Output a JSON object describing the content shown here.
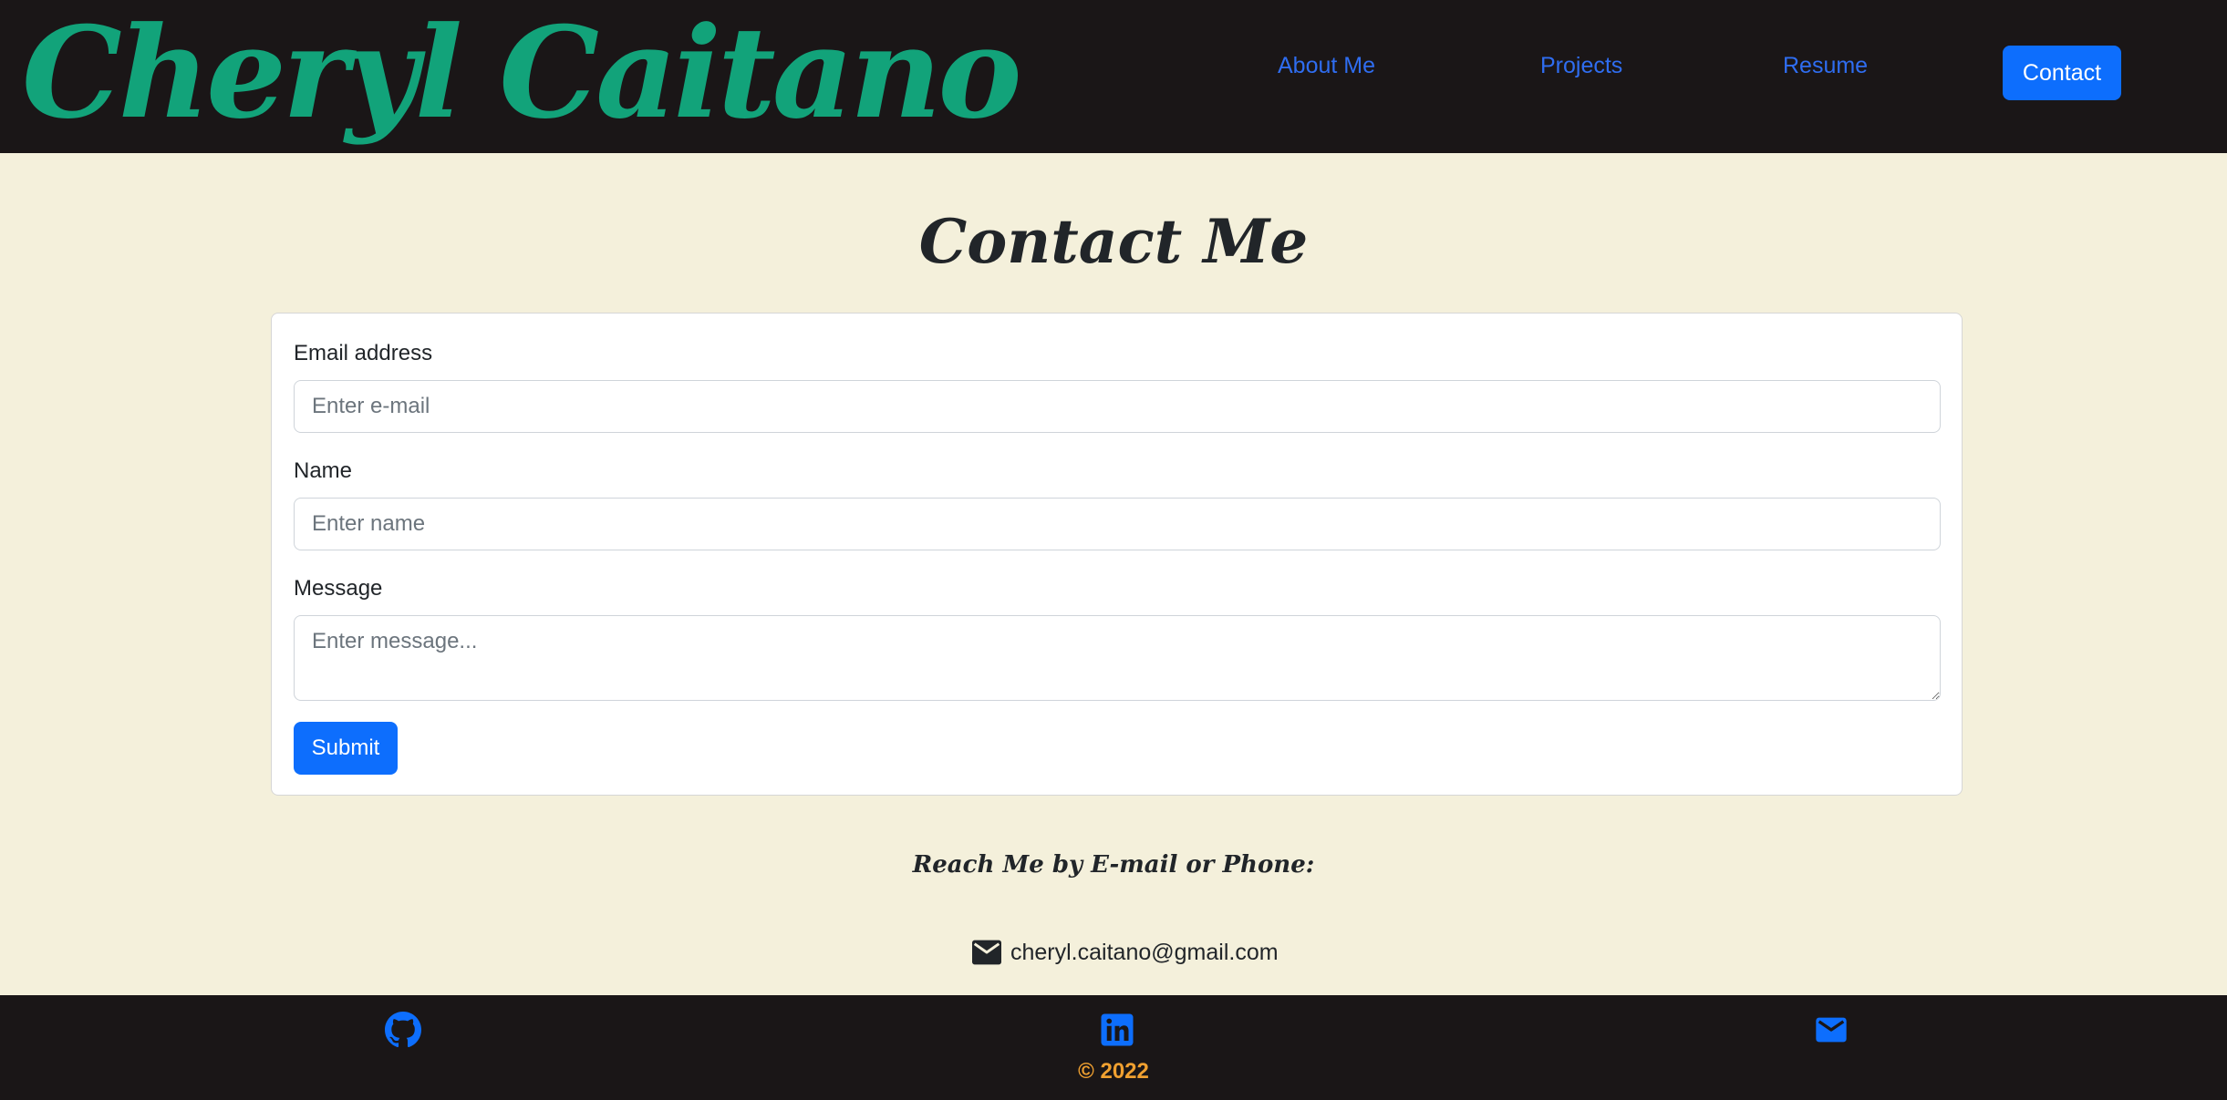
{
  "header": {
    "brand": "Cheryl Caitano",
    "nav": {
      "about": "About Me",
      "projects": "Projects",
      "resume": "Resume",
      "contact": "Contact"
    }
  },
  "main": {
    "title": "Contact Me",
    "form": {
      "email_label": "Email address",
      "email_placeholder": "Enter e-mail",
      "name_label": "Name",
      "name_placeholder": "Enter name",
      "message_label": "Message",
      "message_placeholder": "Enter message...",
      "submit_label": "Submit"
    },
    "reach_heading": "Reach Me by E-mail or Phone:",
    "email": "cheryl.caitano@gmail.com"
  },
  "footer": {
    "icons": [
      "github-icon",
      "linkedin-icon",
      "mail-icon"
    ],
    "copyright": "© 2022"
  },
  "colors": {
    "header_bg": "#1a1617",
    "page_bg": "#f4f0db",
    "brand": "#12a37a",
    "link": "#2f6df0",
    "primary": "#0d6efd",
    "copyright": "#f0a030"
  }
}
